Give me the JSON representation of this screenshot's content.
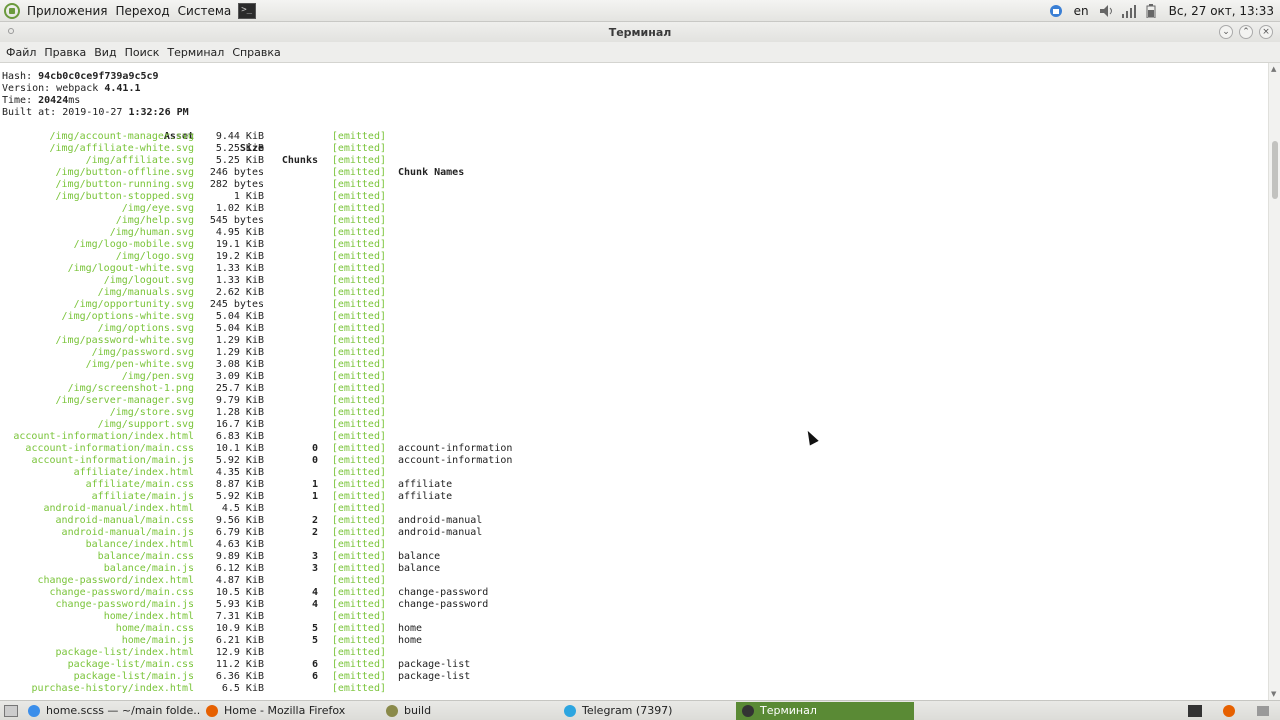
{
  "top_panel": {
    "menu": [
      "Приложения",
      "Переход",
      "Система"
    ],
    "keyboard_layout": "en",
    "clock": "Вс, 27 окт, 13:33"
  },
  "window": {
    "title": "Терминал",
    "menu": [
      "Файл",
      "Правка",
      "Вид",
      "Поиск",
      "Терминал",
      "Справка"
    ]
  },
  "terminal": {
    "hash_label": "Hash:",
    "hash_value": "94cb0c0ce9f739a9c5c9",
    "version_label": "Version: webpack",
    "version_value": "4.41.1",
    "time_label": "Time:",
    "time_value": "20424",
    "time_unit": "ms",
    "built_label": "Built at: 2019-10-27",
    "built_value": "1:32:26 PM",
    "headers": {
      "asset": "Asset",
      "size": "Size",
      "chunks": "Chunks",
      "names": "Chunk Names"
    },
    "rows": [
      {
        "asset": "/img/account-manager.svg",
        "size": "9.44 KiB",
        "chunk": "",
        "status": "[emitted]",
        "name": ""
      },
      {
        "asset": "/img/affiliate-white.svg",
        "size": "5.25 KiB",
        "chunk": "",
        "status": "[emitted]",
        "name": ""
      },
      {
        "asset": "/img/affiliate.svg",
        "size": "5.25 KiB",
        "chunk": "",
        "status": "[emitted]",
        "name": ""
      },
      {
        "asset": "/img/button-offline.svg",
        "size": "246 bytes",
        "chunk": "",
        "status": "[emitted]",
        "name": ""
      },
      {
        "asset": "/img/button-running.svg",
        "size": "282 bytes",
        "chunk": "",
        "status": "[emitted]",
        "name": ""
      },
      {
        "asset": "/img/button-stopped.svg",
        "size": "1 KiB",
        "chunk": "",
        "status": "[emitted]",
        "name": ""
      },
      {
        "asset": "/img/eye.svg",
        "size": "1.02 KiB",
        "chunk": "",
        "status": "[emitted]",
        "name": ""
      },
      {
        "asset": "/img/help.svg",
        "size": "545 bytes",
        "chunk": "",
        "status": "[emitted]",
        "name": ""
      },
      {
        "asset": "/img/human.svg",
        "size": "4.95 KiB",
        "chunk": "",
        "status": "[emitted]",
        "name": ""
      },
      {
        "asset": "/img/logo-mobile.svg",
        "size": "19.1 KiB",
        "chunk": "",
        "status": "[emitted]",
        "name": ""
      },
      {
        "asset": "/img/logo.svg",
        "size": "19.2 KiB",
        "chunk": "",
        "status": "[emitted]",
        "name": ""
      },
      {
        "asset": "/img/logout-white.svg",
        "size": "1.33 KiB",
        "chunk": "",
        "status": "[emitted]",
        "name": ""
      },
      {
        "asset": "/img/logout.svg",
        "size": "1.33 KiB",
        "chunk": "",
        "status": "[emitted]",
        "name": ""
      },
      {
        "asset": "/img/manuals.svg",
        "size": "2.62 KiB",
        "chunk": "",
        "status": "[emitted]",
        "name": ""
      },
      {
        "asset": "/img/opportunity.svg",
        "size": "245 bytes",
        "chunk": "",
        "status": "[emitted]",
        "name": ""
      },
      {
        "asset": "/img/options-white.svg",
        "size": "5.04 KiB",
        "chunk": "",
        "status": "[emitted]",
        "name": ""
      },
      {
        "asset": "/img/options.svg",
        "size": "5.04 KiB",
        "chunk": "",
        "status": "[emitted]",
        "name": ""
      },
      {
        "asset": "/img/password-white.svg",
        "size": "1.29 KiB",
        "chunk": "",
        "status": "[emitted]",
        "name": ""
      },
      {
        "asset": "/img/password.svg",
        "size": "1.29 KiB",
        "chunk": "",
        "status": "[emitted]",
        "name": ""
      },
      {
        "asset": "/img/pen-white.svg",
        "size": "3.08 KiB",
        "chunk": "",
        "status": "[emitted]",
        "name": ""
      },
      {
        "asset": "/img/pen.svg",
        "size": "3.09 KiB",
        "chunk": "",
        "status": "[emitted]",
        "name": ""
      },
      {
        "asset": "/img/screenshot-1.png",
        "size": "25.7 KiB",
        "chunk": "",
        "status": "[emitted]",
        "name": ""
      },
      {
        "asset": "/img/server-manager.svg",
        "size": "9.79 KiB",
        "chunk": "",
        "status": "[emitted]",
        "name": ""
      },
      {
        "asset": "/img/store.svg",
        "size": "1.28 KiB",
        "chunk": "",
        "status": "[emitted]",
        "name": ""
      },
      {
        "asset": "/img/support.svg",
        "size": "16.7 KiB",
        "chunk": "",
        "status": "[emitted]",
        "name": ""
      },
      {
        "asset": "account-information/index.html",
        "size": "6.83 KiB",
        "chunk": "",
        "status": "[emitted]",
        "name": ""
      },
      {
        "asset": "account-information/main.css",
        "size": "10.1 KiB",
        "chunk": "0",
        "status": "[emitted]",
        "name": "account-information"
      },
      {
        "asset": "account-information/main.js",
        "size": "5.92 KiB",
        "chunk": "0",
        "status": "[emitted]",
        "name": "account-information"
      },
      {
        "asset": "affiliate/index.html",
        "size": "4.35 KiB",
        "chunk": "",
        "status": "[emitted]",
        "name": ""
      },
      {
        "asset": "affiliate/main.css",
        "size": "8.87 KiB",
        "chunk": "1",
        "status": "[emitted]",
        "name": "affiliate"
      },
      {
        "asset": "affiliate/main.js",
        "size": "5.92 KiB",
        "chunk": "1",
        "status": "[emitted]",
        "name": "affiliate"
      },
      {
        "asset": "android-manual/index.html",
        "size": "4.5 KiB",
        "chunk": "",
        "status": "[emitted]",
        "name": ""
      },
      {
        "asset": "android-manual/main.css",
        "size": "9.56 KiB",
        "chunk": "2",
        "status": "[emitted]",
        "name": "android-manual"
      },
      {
        "asset": "android-manual/main.js",
        "size": "6.79 KiB",
        "chunk": "2",
        "status": "[emitted]",
        "name": "android-manual"
      },
      {
        "asset": "balance/index.html",
        "size": "4.63 KiB",
        "chunk": "",
        "status": "[emitted]",
        "name": ""
      },
      {
        "asset": "balance/main.css",
        "size": "9.89 KiB",
        "chunk": "3",
        "status": "[emitted]",
        "name": "balance"
      },
      {
        "asset": "balance/main.js",
        "size": "6.12 KiB",
        "chunk": "3",
        "status": "[emitted]",
        "name": "balance"
      },
      {
        "asset": "change-password/index.html",
        "size": "4.87 KiB",
        "chunk": "",
        "status": "[emitted]",
        "name": ""
      },
      {
        "asset": "change-password/main.css",
        "size": "10.5 KiB",
        "chunk": "4",
        "status": "[emitted]",
        "name": "change-password"
      },
      {
        "asset": "change-password/main.js",
        "size": "5.93 KiB",
        "chunk": "4",
        "status": "[emitted]",
        "name": "change-password"
      },
      {
        "asset": "home/index.html",
        "size": "7.31 KiB",
        "chunk": "",
        "status": "[emitted]",
        "name": ""
      },
      {
        "asset": "home/main.css",
        "size": "10.9 KiB",
        "chunk": "5",
        "status": "[emitted]",
        "name": "home"
      },
      {
        "asset": "home/main.js",
        "size": "6.21 KiB",
        "chunk": "5",
        "status": "[emitted]",
        "name": "home"
      },
      {
        "asset": "package-list/index.html",
        "size": "12.9 KiB",
        "chunk": "",
        "status": "[emitted]",
        "name": ""
      },
      {
        "asset": "package-list/main.css",
        "size": "11.2 KiB",
        "chunk": "6",
        "status": "[emitted]",
        "name": "package-list"
      },
      {
        "asset": "package-list/main.js",
        "size": "6.36 KiB",
        "chunk": "6",
        "status": "[emitted]",
        "name": "package-list"
      },
      {
        "asset": "purchase-history/index.html",
        "size": "6.5 KiB",
        "chunk": "",
        "status": "[emitted]",
        "name": ""
      }
    ]
  },
  "taskbar": {
    "tasks": [
      {
        "label": "home.scss — ~/main folde...",
        "icon": "vscode-icon",
        "color": "#3b8eea"
      },
      {
        "label": "Home - Mozilla Firefox",
        "icon": "firefox-icon",
        "color": "#e66000"
      },
      {
        "label": "build",
        "icon": "folder-icon",
        "color": "#8a8a4a"
      },
      {
        "label": "Telegram (7397)",
        "icon": "telegram-icon",
        "color": "#2ca5e0"
      },
      {
        "label": "Терминал",
        "icon": "terminal-icon",
        "color": "#333333"
      }
    ]
  },
  "colors": {
    "emitted": "#7ac43a",
    "active_task": "#5a8a35"
  }
}
